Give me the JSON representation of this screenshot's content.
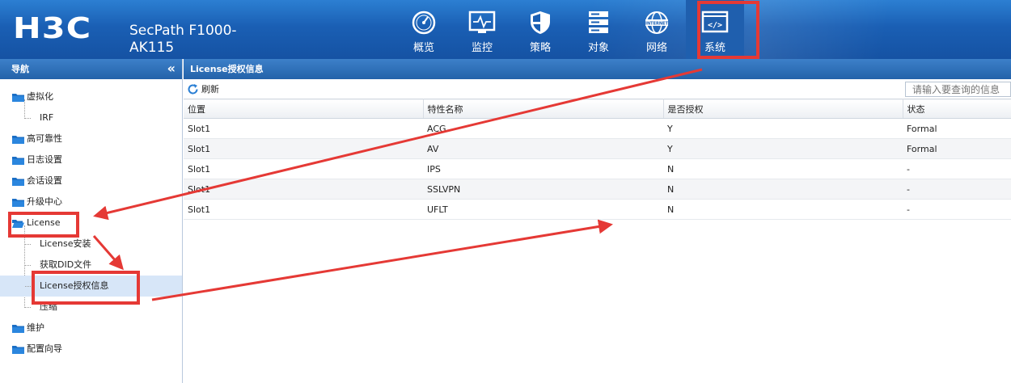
{
  "header": {
    "logo": "H3C",
    "product_line1": "SecPath F1000-",
    "product_line2": "AK115",
    "nav": [
      {
        "label": "概览",
        "icon": "gauge-icon"
      },
      {
        "label": "监控",
        "icon": "monitor-icon"
      },
      {
        "label": "策略",
        "icon": "shield-icon"
      },
      {
        "label": "对象",
        "icon": "server-icon"
      },
      {
        "label": "网络",
        "icon": "globe-icon"
      },
      {
        "label": "系统",
        "icon": "code-icon"
      }
    ],
    "active_nav": "系统"
  },
  "sidebar": {
    "title": "导航",
    "collapse_icon": "«",
    "items": [
      {
        "label": "虚拟化",
        "level": 0
      },
      {
        "label": "IRF",
        "level": 1
      },
      {
        "label": "高可靠性",
        "level": 0
      },
      {
        "label": "日志设置",
        "level": 0
      },
      {
        "label": "会话设置",
        "level": 0
      },
      {
        "label": "升级中心",
        "level": 0
      },
      {
        "label": "License",
        "level": 0
      },
      {
        "label": "License安装",
        "level": 1
      },
      {
        "label": "获取DID文件",
        "level": 1
      },
      {
        "label": "License授权信息",
        "level": 1
      },
      {
        "label": "压缩",
        "level": 1
      },
      {
        "label": "维护",
        "level": 0
      },
      {
        "label": "配置向导",
        "level": 0
      }
    ],
    "selected": "License授权信息"
  },
  "main": {
    "title": "License授权信息",
    "refresh_label": "刷新",
    "search_placeholder": "请输入要查询的信息",
    "columns": [
      "位置",
      "特性名称",
      "是否授权",
      "状态"
    ],
    "rows": [
      [
        "Slot1",
        "ACG",
        "Y",
        "Formal"
      ],
      [
        "Slot1",
        "AV",
        "Y",
        "Formal"
      ],
      [
        "Slot1",
        "IPS",
        "N",
        "-"
      ],
      [
        "Slot1",
        "SSLVPN",
        "N",
        "-"
      ],
      [
        "Slot1",
        "UFLT",
        "N",
        "-"
      ]
    ]
  },
  "colors": {
    "header_blue": "#1a5fb4",
    "panel_head_blue": "#2f6fb8",
    "annotation_red": "#e53935",
    "selected_row": "#d7e6f8"
  }
}
